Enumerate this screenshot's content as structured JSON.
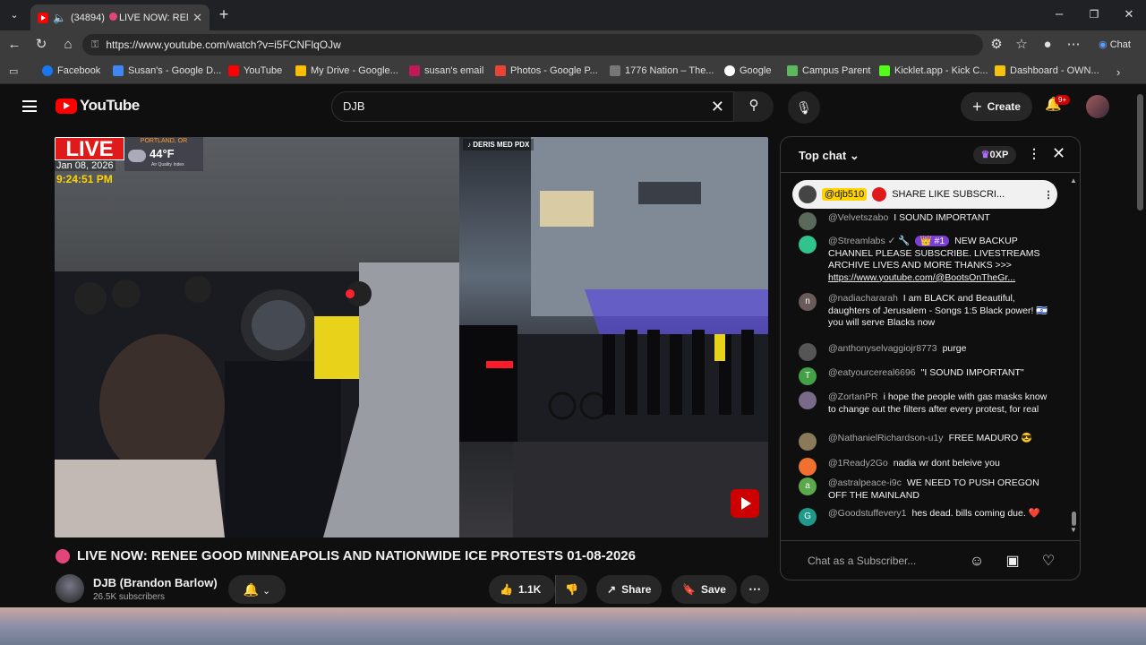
{
  "browser": {
    "tab_title": "(34894)",
    "tab_title_rest": "LIVE NOW: RENE",
    "url": "https://www.youtube.com/watch?v=i5FCNFlqOJw",
    "chat_button": "Chat",
    "bookmarks": [
      "Facebook",
      "Susan's - Google D...",
      "YouTube",
      "My Drive - Google...",
      "susan's email",
      "Photos - Google P...",
      "1776 Nation – The...",
      "Google",
      "Campus Parent",
      "Kicklet.app - Kick C...",
      "Dashboard - OWN..."
    ]
  },
  "youtube": {
    "logo_text": "YouTube",
    "search_value": "DJB",
    "create_label": "Create",
    "notif_badge": "9+"
  },
  "video": {
    "live_label": "LIVE",
    "weather_location": "PORTLAND, OR",
    "weather_temp": "44°F",
    "weather_aq": "Air Quality Index",
    "date": "Jan 08, 2026",
    "time": "9:24:51 PM",
    "tiktok_label": "DERIS MED PDX",
    "title": "LIVE NOW: RENEE GOOD MINNEAPOLIS AND NATIONWIDE ICE PROTESTS 01-08-2026"
  },
  "channel": {
    "name": "DJB (Brandon Barlow)",
    "subscribers": "26.5K subscribers",
    "likes": "1.1K",
    "share_label": "Share",
    "save_label": "Save"
  },
  "chat": {
    "header": "Top chat",
    "xp": "0XP",
    "pinned_author": "@djb510",
    "pinned_text": "SHARE LIKE SUBSCRI...",
    "input_placeholder": "Chat as a Subscriber...",
    "messages": [
      {
        "author": "@Velvetszabo",
        "text": "I SOUND IMPORTANT",
        "avatar_color": "#5a6a5a",
        "avatar_letter": ""
      },
      {
        "author": "@Streamlabs ✓ 🔧",
        "badge": "👑 #1",
        "text": "NEW BACKUP CHANNEL PLEASE SUBSCRIBE. LIVESTREAMS ARCHIVE LIVES AND MORE THANKS >>> ",
        "link": "https://www.youtube.com/@BootsOnTheGr...",
        "avatar_color": "#31c38c",
        "avatar_letter": ""
      },
      {
        "author": "@nadiachararah",
        "text": "I am BLACK and Beautiful, daughters of Jerusalem - Songs 1:5 Black power! 🇮🇱 you will serve Blacks now",
        "avatar_color": "#6b5a5a",
        "avatar_letter": "n"
      },
      {
        "author": "@anthonyselvaggiojr8773",
        "text": "purge",
        "avatar_color": "#555",
        "avatar_letter": ""
      },
      {
        "author": "@eatyourcereal6696",
        "text": "\"I SOUND IMPORTANT\"",
        "avatar_color": "#43a047",
        "avatar_letter": "T"
      },
      {
        "author": "@ZortanPR",
        "text": "i hope the people with gas masks know to change out the filters after every protest, for real",
        "avatar_color": "#7a6a8a",
        "avatar_letter": ""
      },
      {
        "author": "@NathanielRichardson-u1y",
        "text": "FREE MADURO 😎",
        "avatar_color": "#8a7a5a",
        "avatar_letter": ""
      },
      {
        "author": "@1Ready2Go",
        "text": "nadia wr dont beleive you",
        "avatar_color": "#f07030",
        "avatar_letter": ""
      },
      {
        "author": "@astralpeace-i9c",
        "text": "WE NEED TO PUSH OREGON OFF THE MAINLAND",
        "avatar_color": "#5aa84a",
        "avatar_letter": "a"
      },
      {
        "author": "@Goodstuffevery1",
        "text": "hes dead. bills coming due. ❤️",
        "avatar_color": "#1f9a8a",
        "avatar_letter": "G"
      }
    ]
  }
}
